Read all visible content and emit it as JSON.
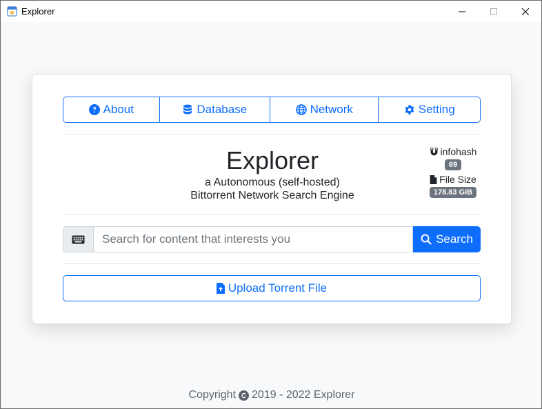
{
  "window": {
    "title": "Explorer"
  },
  "nav": {
    "items": [
      {
        "label": "About",
        "icon": "question-circle-icon"
      },
      {
        "label": "Database",
        "icon": "database-icon"
      },
      {
        "label": "Network",
        "icon": "globe-icon"
      },
      {
        "label": "Setting",
        "icon": "gear-icon"
      }
    ]
  },
  "hero": {
    "title": "Explorer",
    "subtitle_line1": "a Autonomous (self-hosted)",
    "subtitle_line2": "Bittorrent Network Search Engine"
  },
  "stats": {
    "infohash_label": "infohash",
    "infohash_value": "69",
    "filesize_label": "File Size",
    "filesize_value": "178.83 GiB"
  },
  "search": {
    "placeholder": "Search for content that interests you",
    "button_label": "Search"
  },
  "upload": {
    "label": "Upload Torrent File"
  },
  "footer": {
    "prefix": "Copyright",
    "years": "2019 - 2022 Explorer"
  },
  "colors": {
    "primary": "#0d6efd",
    "badge": "#6c757d",
    "page_bg": "#f8f9fb"
  }
}
